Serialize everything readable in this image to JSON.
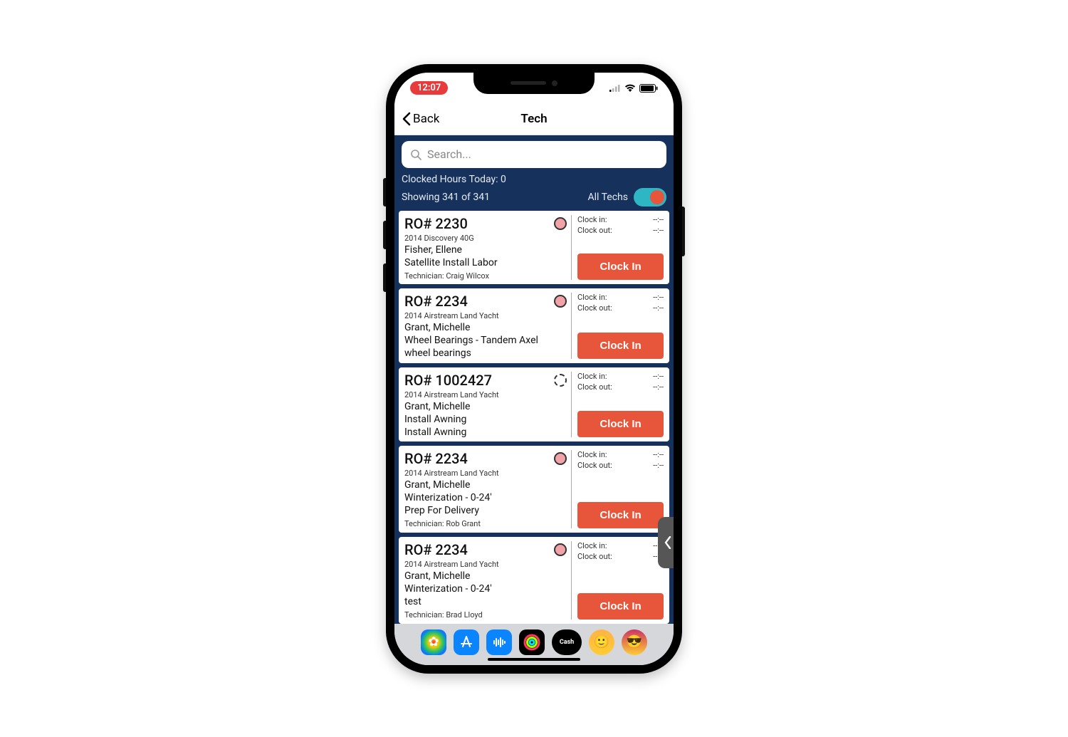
{
  "status": {
    "time": "12:07"
  },
  "nav": {
    "back_label": "Back",
    "title": "Tech"
  },
  "search": {
    "placeholder": "Search..."
  },
  "summary": {
    "clocked_hours_label": "Clocked Hours Today: 0",
    "showing_label": "Showing 341 of 341",
    "toggle_label": "All Techs"
  },
  "labels": {
    "clock_in": "Clock in:",
    "clock_out": "Clock out:",
    "cta": "Clock In",
    "cash": "Cash"
  },
  "jobs": [
    {
      "ro": "RO# 2230",
      "status_style": "solid",
      "vehicle": "2014 Discovery 40G",
      "customer": "Fisher, Ellene",
      "task": "Satellite Install Labor",
      "detail": "",
      "technician": "Technician: Craig Wilcox",
      "clock_in": "--:--",
      "clock_out": "--:--"
    },
    {
      "ro": "RO# 2234",
      "status_style": "solid",
      "vehicle": "2014 Airstream Land Yacht",
      "customer": "Grant, Michelle",
      "task": "Wheel Bearings - Tandem Axel",
      "detail": "wheel bearings",
      "technician": "",
      "clock_in": "--:--",
      "clock_out": "--:--"
    },
    {
      "ro": "RO# 1002427",
      "status_style": "dashed",
      "vehicle": "2014 Airstream Land Yacht",
      "customer": "Grant, Michelle",
      "task": "Install Awning",
      "detail": "Install Awning",
      "technician": "",
      "clock_in": "--:--",
      "clock_out": "--:--"
    },
    {
      "ro": "RO# 2234",
      "status_style": "solid",
      "vehicle": "2014 Airstream Land Yacht",
      "customer": "Grant, Michelle",
      "task": "Winterization - 0-24'",
      "detail": "Prep For Delivery",
      "technician": "Technician: Rob Grant",
      "clock_in": "--:--",
      "clock_out": "--:--"
    },
    {
      "ro": "RO# 2234",
      "status_style": "solid",
      "vehicle": "2014 Airstream Land Yacht",
      "customer": "Grant, Michelle",
      "task": "Winterization - 0-24'",
      "detail": "test",
      "technician": "Technician: Brad Lloyd",
      "clock_in": "--:--",
      "clock_out": "--:--"
    }
  ]
}
